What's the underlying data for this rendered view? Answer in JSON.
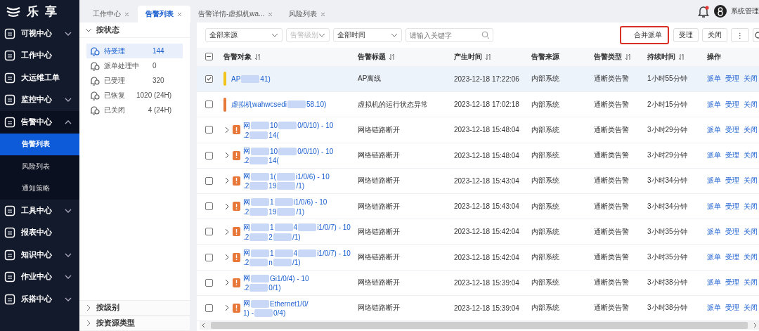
{
  "logo": {
    "text": "乐 享"
  },
  "sidebar": {
    "items": [
      {
        "label": "可视中心",
        "expandable": true,
        "expanded": false
      },
      {
        "label": "工作中心",
        "expandable": false,
        "expanded": false
      },
      {
        "label": "大运维工单",
        "expandable": false,
        "expanded": false
      },
      {
        "label": "监控中心",
        "expandable": true,
        "expanded": false
      },
      {
        "label": "告警中心",
        "expandable": true,
        "expanded": true,
        "children": [
          {
            "label": "告警列表",
            "selected": true
          },
          {
            "label": "风险列表",
            "selected": false
          },
          {
            "label": "通知策略",
            "selected": false
          }
        ]
      },
      {
        "label": "工具中心",
        "expandable": true,
        "expanded": false
      },
      {
        "label": "报表中心",
        "expandable": false,
        "expanded": false
      },
      {
        "label": "知识中心",
        "expandable": true,
        "expanded": false
      },
      {
        "label": "作业中心",
        "expandable": true,
        "expanded": false
      },
      {
        "label": "乐搭中心",
        "expandable": true,
        "expanded": false
      }
    ]
  },
  "tabs": [
    {
      "label": "工作中心",
      "selected": false
    },
    {
      "label": "告警列表",
      "selected": true
    },
    {
      "label": "告警详情-虚拟机wa...",
      "selected": false
    },
    {
      "label": "风险列表",
      "selected": false
    }
  ],
  "header": {
    "user": "系统管理",
    "notification": true
  },
  "status_panel": {
    "title": "按状态",
    "expanded": true,
    "items": [
      {
        "label": "待受理",
        "count": "144",
        "selected": true
      },
      {
        "label": "派单处理中",
        "count": "0",
        "selected": false
      },
      {
        "label": "已受理",
        "count": "320",
        "selected": false
      },
      {
        "label": "已恢复",
        "count": "1020 (24H)",
        "selected": false
      },
      {
        "label": "已关闭",
        "count": "4 (24H)",
        "selected": false
      }
    ],
    "collapsed_sections": [
      "按级别",
      "按资源类型"
    ]
  },
  "filters": [
    {
      "value": "全部来源",
      "placeholder": false
    },
    {
      "value": "告警级别",
      "placeholder": true
    },
    {
      "value": "全部时间",
      "placeholder": false
    }
  ],
  "search": {
    "placeholder": "请输入关键字"
  },
  "actions": [
    {
      "label": "合并派单",
      "highlighted": true
    },
    {
      "label": "受理",
      "highlighted": false
    },
    {
      "label": "关闭",
      "highlighted": false
    },
    {
      "label": "⋮",
      "highlighted": false
    }
  ],
  "table": {
    "indeterminate": true,
    "columns": [
      {
        "label": "告警对象",
        "sortable": true
      },
      {
        "label": "告警标题",
        "sortable": true
      },
      {
        "label": "产生时间",
        "sortable": true
      },
      {
        "label": "告警来源",
        "sortable": false
      },
      {
        "label": "告警类型",
        "sortable": true
      },
      {
        "label": "持续时间",
        "sortable": true
      },
      {
        "label": "操作",
        "sortable": false
      }
    ],
    "rows": [
      {
        "checked": true,
        "selected": true,
        "kind": "bar",
        "color": "#f0c419",
        "object": [
          [
            "AP",
            "41)"
          ]
        ],
        "title": "AP离线",
        "time": "2023-12-18 17:22:06",
        "source": "内部系统",
        "type": "通断类告警",
        "duration": "1小时55分钟",
        "ops": [
          "派单",
          "受理",
          "关闭"
        ]
      },
      {
        "checked": false,
        "selected": false,
        "kind": "bar",
        "color": "#e8773a",
        "object": [
          [
            "虚拟机wahwcsedi",
            "58.10)"
          ]
        ],
        "title": "虚拟机的运行状态异常",
        "time": "2023-12-18 17:02:18",
        "source": "内部系统",
        "type": "通断类告警",
        "duration": "2小时15分钟",
        "ops": [
          "派单",
          "受理",
          "关闭"
        ]
      },
      {
        "checked": false,
        "selected": false,
        "kind": "badge",
        "color": "#e8773a",
        "object": [
          [
            "网",
            "10",
            "0/0/10) - 10"
          ],
          [
            ".2",
            "14("
          ]
        ],
        "title": "网络链路断开",
        "time": "2023-12-18 15:48:04",
        "source": "内部系统",
        "type": "通断类告警",
        "duration": "3小时29分钟",
        "ops": [
          "派单",
          "受理",
          "关闭"
        ]
      },
      {
        "checked": false,
        "selected": false,
        "kind": "badge",
        "color": "#e8773a",
        "object": [
          [
            "网",
            "10",
            "0/0/10) - 10"
          ],
          [
            ".2",
            "14("
          ]
        ],
        "title": "网络链路断开",
        "time": "2023-12-18 15:48:04",
        "source": "内部系统",
        "type": "通断类告警",
        "duration": "3小时29分钟",
        "ops": [
          "派单",
          "受理",
          "关闭"
        ]
      },
      {
        "checked": false,
        "selected": false,
        "kind": "badge",
        "color": "#e8773a",
        "object": [
          [
            "网",
            "1(",
            "i1/0/6) - 10"
          ],
          [
            ".2",
            "19",
            "/1)"
          ]
        ],
        "title": "网络链路断开",
        "time": "2023-12-18 15:43:04",
        "source": "内部系统",
        "type": "通断类告警",
        "duration": "3小时34分钟",
        "ops": [
          "派单",
          "受理",
          "关闭"
        ]
      },
      {
        "checked": false,
        "selected": false,
        "kind": "badge",
        "color": "#e8773a",
        "object": [
          [
            "网",
            "1",
            "i1/0/6) - 10"
          ],
          [
            ".2",
            "19",
            "/1)"
          ]
        ],
        "title": "网络链路断开",
        "time": "2023-12-18 15:43:04",
        "source": "内部系统",
        "type": "通断类告警",
        "duration": "3小时34分钟",
        "ops": [
          "派单",
          "受理",
          "关闭"
        ]
      },
      {
        "checked": false,
        "selected": false,
        "kind": "badge",
        "color": "#e8773a",
        "object": [
          [
            "网",
            "1",
            "4",
            "i1/0/7) - 10"
          ],
          [
            ".2",
            "2",
            "/1)"
          ]
        ],
        "title": "网络链路断开",
        "time": "2023-12-18 15:42:04",
        "source": "内部系统",
        "type": "通断类告警",
        "duration": "3小时35分钟",
        "ops": [
          "派单",
          "受理",
          "关闭"
        ]
      },
      {
        "checked": false,
        "selected": false,
        "kind": "badge",
        "color": "#e8773a",
        "object": [
          [
            "网",
            "1",
            "4",
            "i1/0/7) - 10"
          ],
          [
            ".2",
            "n",
            "/1)"
          ]
        ],
        "title": "网络链路断开",
        "time": "2023-12-18 15:42:04",
        "source": "内部系统",
        "type": "通断类告警",
        "duration": "3小时35分钟",
        "ops": [
          "派单",
          "受理",
          "关闭"
        ]
      },
      {
        "checked": false,
        "selected": false,
        "kind": "badge",
        "color": "#e8773a",
        "object": [
          [
            "网",
            "Gi1/0/4) - 10"
          ],
          [
            ".2",
            "0/1)"
          ]
        ],
        "title": "网络链路断开",
        "time": "2023-12-18 15:39:04",
        "source": "内部系统",
        "type": "通断类告警",
        "duration": "3小时38分钟",
        "ops": [
          "派单",
          "受理",
          "关闭"
        ]
      },
      {
        "checked": false,
        "selected": false,
        "kind": "badge",
        "color": "#e8773a",
        "object": [
          [
            "网",
            "Ethernet1/0/"
          ],
          [
            "1) -",
            "0/4)"
          ]
        ],
        "title": "网络链路断开",
        "time": "2023-12-18 15:39:04",
        "source": "内部系统",
        "type": "通断类告警",
        "duration": "3小时38分钟",
        "ops": [
          "派单",
          "受理",
          "关闭"
        ]
      }
    ]
  }
}
